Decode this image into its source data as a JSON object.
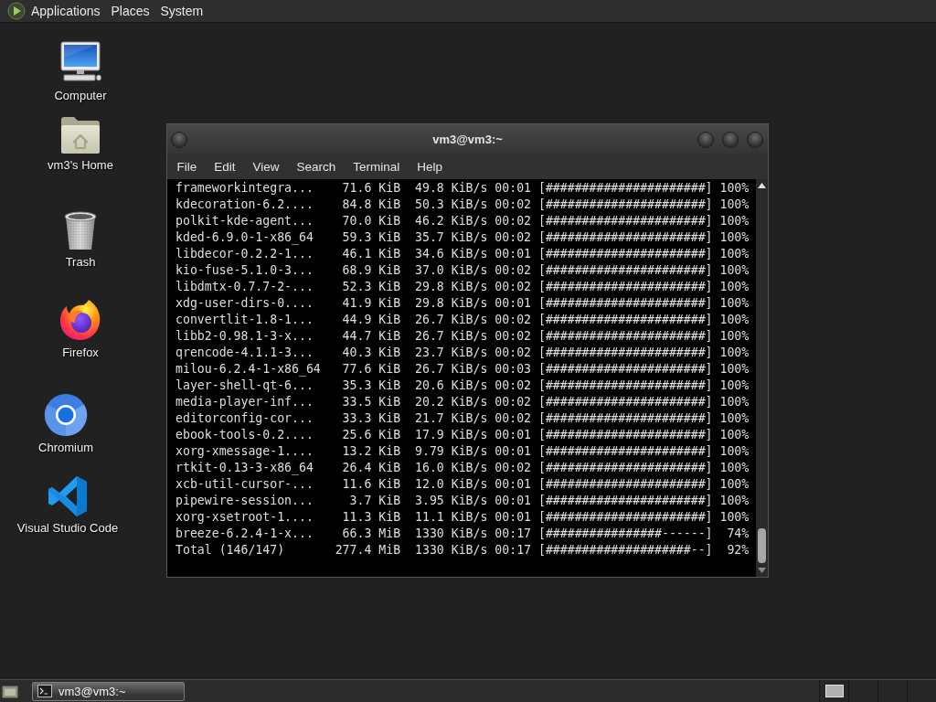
{
  "top_panel": {
    "menus": [
      "Applications",
      "Places",
      "System"
    ]
  },
  "desktop_icons": [
    {
      "label": "Computer",
      "kind": "computer"
    },
    {
      "label": "vm3's Home",
      "kind": "home"
    },
    {
      "label": "Trash",
      "kind": "trash"
    },
    {
      "label": "Firefox",
      "kind": "firefox"
    },
    {
      "label": "Chromium",
      "kind": "chromium"
    },
    {
      "label": "Visual Studio Code",
      "kind": "vscode"
    }
  ],
  "terminal": {
    "title": "vm3@vm3:~",
    "menu": [
      "File",
      "Edit",
      "View",
      "Search",
      "Terminal",
      "Help"
    ],
    "lines": [
      "frameworkintegra...    71.6 KiB  49.8 KiB/s 00:01 [######################] 100%",
      "kdecoration-6.2....    84.8 KiB  50.3 KiB/s 00:02 [######################] 100%",
      "polkit-kde-agent...    70.0 KiB  46.2 KiB/s 00:02 [######################] 100%",
      "kded-6.9.0-1-x86_64    59.3 KiB  35.7 KiB/s 00:02 [######################] 100%",
      "libdecor-0.2.2-1...    46.1 KiB  34.6 KiB/s 00:01 [######################] 100%",
      "kio-fuse-5.1.0-3...    68.9 KiB  37.0 KiB/s 00:02 [######################] 100%",
      "libdmtx-0.7.7-2-...    52.3 KiB  29.8 KiB/s 00:02 [######################] 100%",
      "xdg-user-dirs-0....    41.9 KiB  29.8 KiB/s 00:01 [######################] 100%",
      "convertlit-1.8-1...    44.9 KiB  26.7 KiB/s 00:02 [######################] 100%",
      "libb2-0.98.1-3-x...    44.7 KiB  26.7 KiB/s 00:02 [######################] 100%",
      "qrencode-4.1.1-3...    40.3 KiB  23.7 KiB/s 00:02 [######################] 100%",
      "milou-6.2.4-1-x86_64   77.6 KiB  26.7 KiB/s 00:03 [######################] 100%",
      "layer-shell-qt-6...    35.3 KiB  20.6 KiB/s 00:02 [######################] 100%",
      "media-player-inf...    33.5 KiB  20.2 KiB/s 00:02 [######################] 100%",
      "editorconfig-cor...    33.3 KiB  21.7 KiB/s 00:02 [######################] 100%",
      "ebook-tools-0.2....    25.6 KiB  17.9 KiB/s 00:01 [######################] 100%",
      "xorg-xmessage-1....    13.2 KiB  9.79 KiB/s 00:01 [######################] 100%",
      "rtkit-0.13-3-x86_64    26.4 KiB  16.0 KiB/s 00:02 [######################] 100%",
      "xcb-util-cursor-...    11.6 KiB  12.0 KiB/s 00:01 [######################] 100%",
      "pipewire-session...     3.7 KiB  3.95 KiB/s 00:01 [######################] 100%",
      "xorg-xsetroot-1....    11.3 KiB  11.1 KiB/s 00:01 [######################] 100%",
      "breeze-6.2.4-1-x...    66.3 MiB  1330 KiB/s 00:17 [################------]  74%",
      "Total (146/147)       277.4 MiB  1330 KiB/s 00:17 [####################--]  92%"
    ]
  },
  "taskbar": {
    "tasks": [
      {
        "label": "vm3@vm3:~",
        "selected": true
      }
    ]
  }
}
